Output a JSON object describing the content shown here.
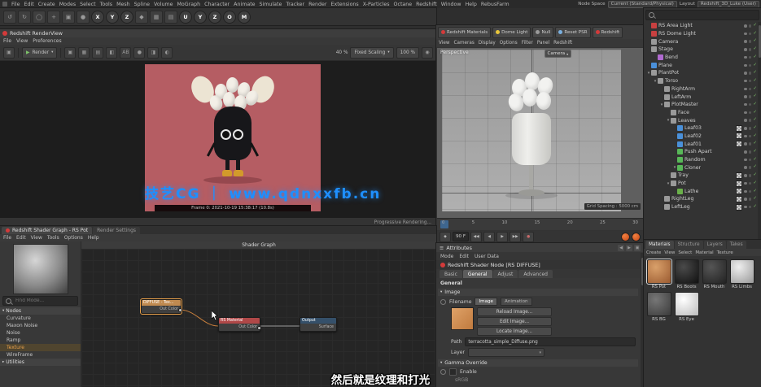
{
  "menubar": {
    "items": [
      "File",
      "Edit",
      "Create",
      "Modes",
      "Select",
      "Tools",
      "Mesh",
      "Spline",
      "Volume",
      "MoGraph",
      "Character",
      "Animate",
      "Simulate",
      "Tracker",
      "Render",
      "Extensions",
      "X-Particles",
      "Octane",
      "Redshift",
      "Window",
      "Help",
      "RebusFarm"
    ],
    "node_space_label": "Node Space",
    "node_space_value": "Current (Standard/Physical)",
    "layout_label": "Layout",
    "layout_value": "Redshift_3D_Luke (User)"
  },
  "toolbar": {
    "icons": [
      {
        "name": "undo-icon",
        "glyph": "↺"
      },
      {
        "name": "redo-icon",
        "glyph": "↻"
      },
      {
        "name": "live-selection-icon",
        "glyph": "◯"
      },
      {
        "name": "move-tool-icon",
        "glyph": "+"
      },
      {
        "name": "scale-tool-icon",
        "glyph": "▣"
      },
      {
        "name": "rotate-tool-icon",
        "glyph": "●"
      },
      {
        "name": "axis-x-icon",
        "glyph": "X",
        "color": "#b03a3a"
      },
      {
        "name": "axis-y-icon",
        "glyph": "Y",
        "color": "#6fae3a"
      },
      {
        "name": "axis-z-icon",
        "glyph": "Z",
        "color": "#2f7fc8"
      },
      {
        "name": "coordinate-system-icon",
        "glyph": "◆"
      },
      {
        "name": "render-view-icon",
        "glyph": "▦"
      },
      {
        "name": "render-settings-icon",
        "glyph": "▤"
      },
      {
        "name": "plugin-u-icon",
        "glyph": "U",
        "color": "#6fae3a"
      },
      {
        "name": "plugin-y-icon",
        "glyph": "Y",
        "color": "#d4b22a"
      },
      {
        "name": "plugin-z-icon",
        "glyph": "Z",
        "color": "#2fa8a8"
      },
      {
        "name": "octane-icon",
        "glyph": "O",
        "color": "#c0392b"
      },
      {
        "name": "magic-icon",
        "glyph": "M",
        "color": "#8e44ad"
      }
    ]
  },
  "renderview": {
    "title": "Redshift RenderView",
    "menu": [
      "File",
      "View",
      "Preferences"
    ],
    "render_dropdown": "Render",
    "tool_icons": [
      {
        "name": "snapshot-icon",
        "glyph": "▣"
      },
      {
        "name": "grid-overlay-icon",
        "glyph": "▦"
      },
      {
        "name": "channels-icon",
        "glyph": "▤"
      },
      {
        "name": "region-render-icon",
        "glyph": "◧"
      },
      {
        "name": "compare-ab-icon",
        "glyph": "AB"
      },
      {
        "name": "clay-render-icon",
        "glyph": "●"
      },
      {
        "name": "snapshot-list-icon",
        "glyph": "◨"
      },
      {
        "name": "color-picker-icon",
        "glyph": "◐"
      }
    ],
    "zoom_value": "40 %",
    "fixed_scaling": "Fixed Scaling",
    "scale_value": "100 %",
    "frame_info": "Frame  0:  2021-10-19  15:38:17  (10.8s)",
    "progressive": "Progressive Rendering..."
  },
  "viewport": {
    "buttons": [
      {
        "label": "Redshift Materials",
        "color": "#d43a3a"
      },
      {
        "label": "Dome Light",
        "color": "#e8c63a"
      },
      {
        "label": "Null",
        "color": "#9a9a9a"
      },
      {
        "label": "Reset PSR",
        "color": "#7ab0e0"
      },
      {
        "label": "Redshift",
        "color": "#d43a3a"
      }
    ],
    "menu": [
      "View",
      "Cameras",
      "Display",
      "Options",
      "Filter",
      "Panel",
      "Redshift"
    ],
    "label": "Perspective",
    "camera_label": "Camera",
    "grid_spacing": "Grid Spacing : 5000 cm",
    "timeline_ticks": [
      "0",
      "5",
      "10",
      "15",
      "20",
      "25",
      "30"
    ],
    "frame_field": "90 F",
    "transport": [
      {
        "name": "goto-start-icon",
        "glyph": "◀◀"
      },
      {
        "name": "previous-frame-icon",
        "glyph": "◀"
      },
      {
        "name": "play-forward-icon",
        "glyph": "▶"
      },
      {
        "name": "goto-end-icon",
        "glyph": "▶▶"
      }
    ]
  },
  "object_manager": {
    "items": [
      {
        "label": "RS Area Light",
        "indent": 0,
        "color": "#c84040"
      },
      {
        "label": "RS Dome Light",
        "indent": 0,
        "color": "#c84040"
      },
      {
        "label": "Camera",
        "indent": 0,
        "color": "#9a9a9a"
      },
      {
        "label": "Stage",
        "indent": 0,
        "color": "#9a9a9a"
      },
      {
        "label": "Bend",
        "indent": 1,
        "color": "#b06ad0"
      },
      {
        "label": "Plane",
        "indent": 0,
        "color": "#4a90d9"
      },
      {
        "label": "PlantPot",
        "indent": 0,
        "color": "#9a9a9a",
        "arrow": "▾"
      },
      {
        "label": "Torso",
        "indent": 1,
        "color": "#9a9a9a",
        "arrow": "▾"
      },
      {
        "label": "RightArm",
        "indent": 2,
        "color": "#9a9a9a"
      },
      {
        "label": "LeftArm",
        "indent": 2,
        "color": "#9a9a9a"
      },
      {
        "label": "PlotMaster",
        "indent": 2,
        "color": "#9a9a9a",
        "arrow": "▾"
      },
      {
        "label": "Face",
        "indent": 3,
        "color": "#9a9a9a"
      },
      {
        "label": "Leaves",
        "indent": 3,
        "color": "#9a9a9a",
        "arrow": "▾"
      },
      {
        "label": "Leaf03",
        "indent": 4,
        "color": "#4a90d9",
        "tag": true
      },
      {
        "label": "Leaf02",
        "indent": 4,
        "color": "#4a90d9",
        "tag": true
      },
      {
        "label": "Leaf01",
        "indent": 4,
        "color": "#4a90d9",
        "tag": true
      },
      {
        "label": "Push Apart",
        "indent": 4,
        "color": "#58b858"
      },
      {
        "label": "Random",
        "indent": 4,
        "color": "#58b858"
      },
      {
        "label": "Cloner",
        "indent": 4,
        "color": "#58b858",
        "arrow": "▾"
      },
      {
        "label": "Tray",
        "indent": 3,
        "color": "#9a9a9a",
        "tag": true
      },
      {
        "label": "Pot",
        "indent": 3,
        "color": "#9a9a9a",
        "arrow": "▾",
        "tag": true
      },
      {
        "label": "Lathe",
        "indent": 4,
        "color": "#6ab04a",
        "tag": true
      },
      {
        "label": "RightLeg",
        "indent": 2,
        "color": "#9a9a9a",
        "tag": true
      },
      {
        "label": "LeftLeg",
        "indent": 2,
        "color": "#9a9a9a",
        "tag": true
      }
    ]
  },
  "shader_editor": {
    "window_title": "Redshift Shader Graph - RS Pot",
    "secondary_tab": "Render Settings",
    "menu": [
      "File",
      "Edit",
      "View",
      "Tools",
      "Options",
      "Help"
    ],
    "graph_title": "Shader Graph",
    "find_placeholder": "Find Mode...",
    "nodes_header": "Nodes",
    "node_list": [
      {
        "label": "Curvature"
      },
      {
        "label": "Maxon Noise"
      },
      {
        "label": "Noise"
      },
      {
        "label": "Ramp"
      },
      {
        "label": "Texture",
        "selected": true
      },
      {
        "label": "WireFrame"
      }
    ],
    "utilities_header": "Utilities",
    "texture_node": {
      "title": "DIFFUSE - Tex...",
      "port": "Out Color"
    },
    "material_node": {
      "title": "RS Material",
      "port": "Out Color"
    },
    "output_node": {
      "title": "Output",
      "port": "Surface"
    }
  },
  "attributes": {
    "title": "Attributes",
    "menu": [
      "Mode",
      "Edit",
      "User Data"
    ],
    "node_title": "Redshift Shader Node [RS DIFFUSE]",
    "tabs": [
      {
        "label": "Basic"
      },
      {
        "label": "General",
        "selected": true
      },
      {
        "label": "Adjust"
      },
      {
        "label": "Advanced"
      }
    ],
    "section_general": "General",
    "image_section": "Image",
    "filename_label": "Filename",
    "image_tab": "Image",
    "animation_tab": "Animation",
    "buttons": [
      "Reload Image...",
      "Edit Image...",
      "Locate Image..."
    ],
    "path_label": "Path",
    "path_value": "terracotta_simple_Diffuse.png",
    "layer_label": "Layer",
    "gamma_section": "Gamma Override",
    "enable_label": "Enable",
    "srgb_label": "sRGB"
  },
  "materials_panel": {
    "tabs": [
      {
        "label": "Materials",
        "selected": true
      },
      {
        "label": "Structure"
      },
      {
        "label": "Layers"
      },
      {
        "label": "Takes"
      }
    ],
    "menu": [
      "Create",
      "View",
      "Select",
      "Material",
      "Texture"
    ],
    "items": [
      {
        "label": "RS Pot",
        "color": "#9a5a30",
        "hi": "#d9a06a",
        "selected": true
      },
      {
        "label": "RS Boots",
        "color": "#111111",
        "hi": "#4a4a4a"
      },
      {
        "label": "RS Mouth",
        "color": "#222222",
        "hi": "#555555"
      },
      {
        "label": "RS Limbs",
        "color": "#999999",
        "hi": "#eeeeee"
      },
      {
        "label": "RS BG",
        "color": "#3a3a3a",
        "hi": "#777777"
      },
      {
        "label": "RS Eye",
        "color": "#bbbbbb",
        "hi": "#ffffff"
      }
    ]
  },
  "watermark": "技艺CG ｜ www.qdnxxfb.cn",
  "subtitle": "然后就是纹理和打光"
}
